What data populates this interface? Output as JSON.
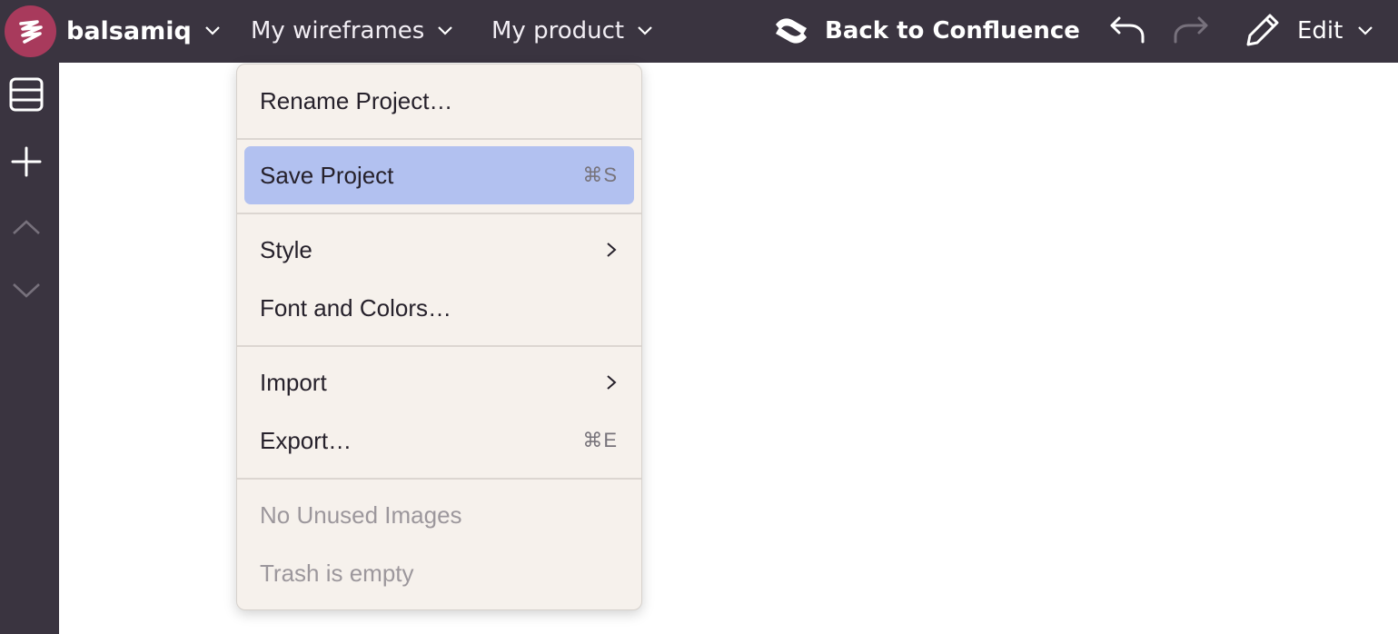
{
  "topbar": {
    "brand": "balsamiq",
    "menus": [
      {
        "label": "My wireframes"
      },
      {
        "label": "My product"
      }
    ],
    "back_link": "Back to Confluence",
    "edit_label": "Edit"
  },
  "rail": {
    "icons": [
      "layout-icon",
      "plus-icon",
      "chevron-up-icon",
      "chevron-down-icon"
    ]
  },
  "menu": {
    "items": [
      {
        "label": "Rename Project…",
        "shortcut": "",
        "submenu": false,
        "state": "normal"
      },
      {
        "label": "Save Project",
        "shortcut": "⌘S",
        "submenu": false,
        "state": "highlighted"
      },
      {
        "label": "Style",
        "shortcut": "",
        "submenu": true,
        "state": "normal"
      },
      {
        "label": "Font and Colors…",
        "shortcut": "",
        "submenu": false,
        "state": "normal"
      },
      {
        "label": "Import",
        "shortcut": "",
        "submenu": true,
        "state": "normal"
      },
      {
        "label": "Export…",
        "shortcut": "⌘E",
        "submenu": false,
        "state": "normal"
      },
      {
        "label": "No Unused Images",
        "shortcut": "",
        "submenu": false,
        "state": "disabled"
      },
      {
        "label": "Trash is empty",
        "shortcut": "",
        "submenu": false,
        "state": "disabled"
      }
    ]
  },
  "colors": {
    "chrome": "#3a3440",
    "logo": "#a83a5c",
    "menu_bg": "#f6f1ec",
    "highlight": "#b2c1f0"
  }
}
